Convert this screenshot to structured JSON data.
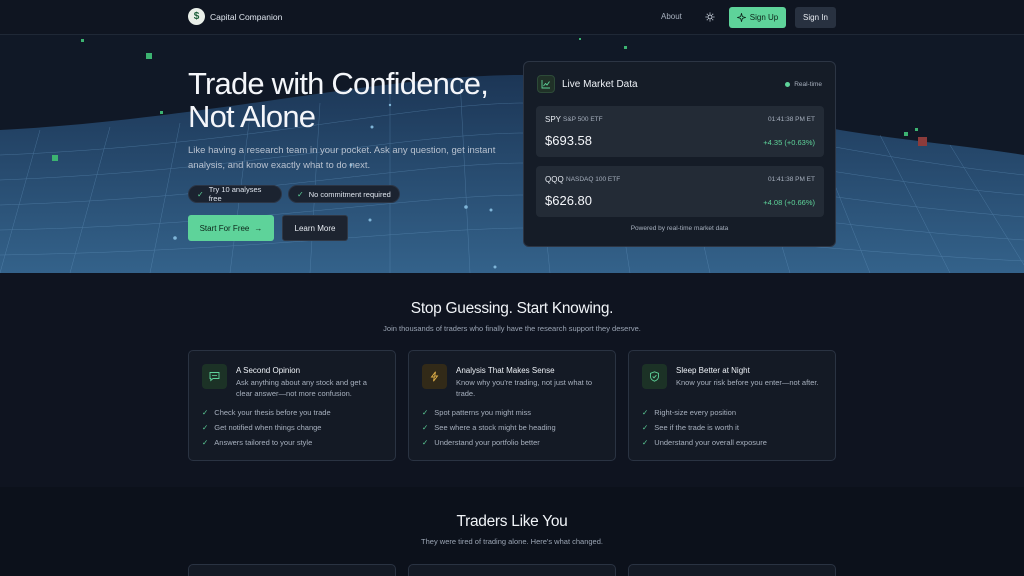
{
  "nav": {
    "brand_name": "Capital Companion",
    "logo_icon": "money-bag-icon",
    "about_label": "About",
    "theme_icon": "sun-icon",
    "signup_label": "Sign Up",
    "signin_label": "Sign In"
  },
  "hero": {
    "title": "Trade with Confidence, Not Alone",
    "subtitle": "Like having a research team in your pocket. Ask any question, get instant analysis, and know exactly what to do next.",
    "pills": [
      "Try 10 analyses free",
      "No commitment required"
    ],
    "start_label": "Start For Free",
    "learn_label": "Learn More"
  },
  "market": {
    "title": "Live Market Data",
    "status": "Real-time",
    "tickers": [
      {
        "symbol": "SPY",
        "desc": "S&P 500 ETF",
        "time": "01:41:38 PM ET",
        "price": "$693.58",
        "change": "+4.35 (+0.63%)"
      },
      {
        "symbol": "QQQ",
        "desc": "NASDAQ 100 ETF",
        "time": "01:41:38 PM ET",
        "price": "$626.80",
        "change": "+4.08 (+0.66%)"
      }
    ],
    "powered": "Powered by real-time market data"
  },
  "features": {
    "title": "Stop Guessing. Start Knowing.",
    "subtitle": "Join thousands of traders who finally have the research support they deserve.",
    "cards": [
      {
        "title": "A Second Opinion",
        "desc": "Ask anything about any stock and get a clear answer—not more confusion.",
        "icon": "chat-icon",
        "items": [
          "Check your thesis before you trade",
          "Get notified when things change",
          "Answers tailored to your style"
        ]
      },
      {
        "title": "Analysis That Makes Sense",
        "desc": "Know why you're trading, not just what to trade.",
        "icon": "lightning-icon",
        "items": [
          "Spot patterns you might miss",
          "See where a stock might be heading",
          "Understand your portfolio better"
        ]
      },
      {
        "title": "Sleep Better at Night",
        "desc": "Know your risk before you enter—not after.",
        "icon": "shield-check-icon",
        "items": [
          "Right-size every position",
          "See if the trade is worth it",
          "Understand your overall exposure"
        ]
      }
    ]
  },
  "testimonials": {
    "title": "Traders Like You",
    "subtitle": "They were tired of trading alone. Here's what changed."
  },
  "colors": {
    "accent": "#5ed39a",
    "background": "#0e1420",
    "card": "#151c27"
  }
}
